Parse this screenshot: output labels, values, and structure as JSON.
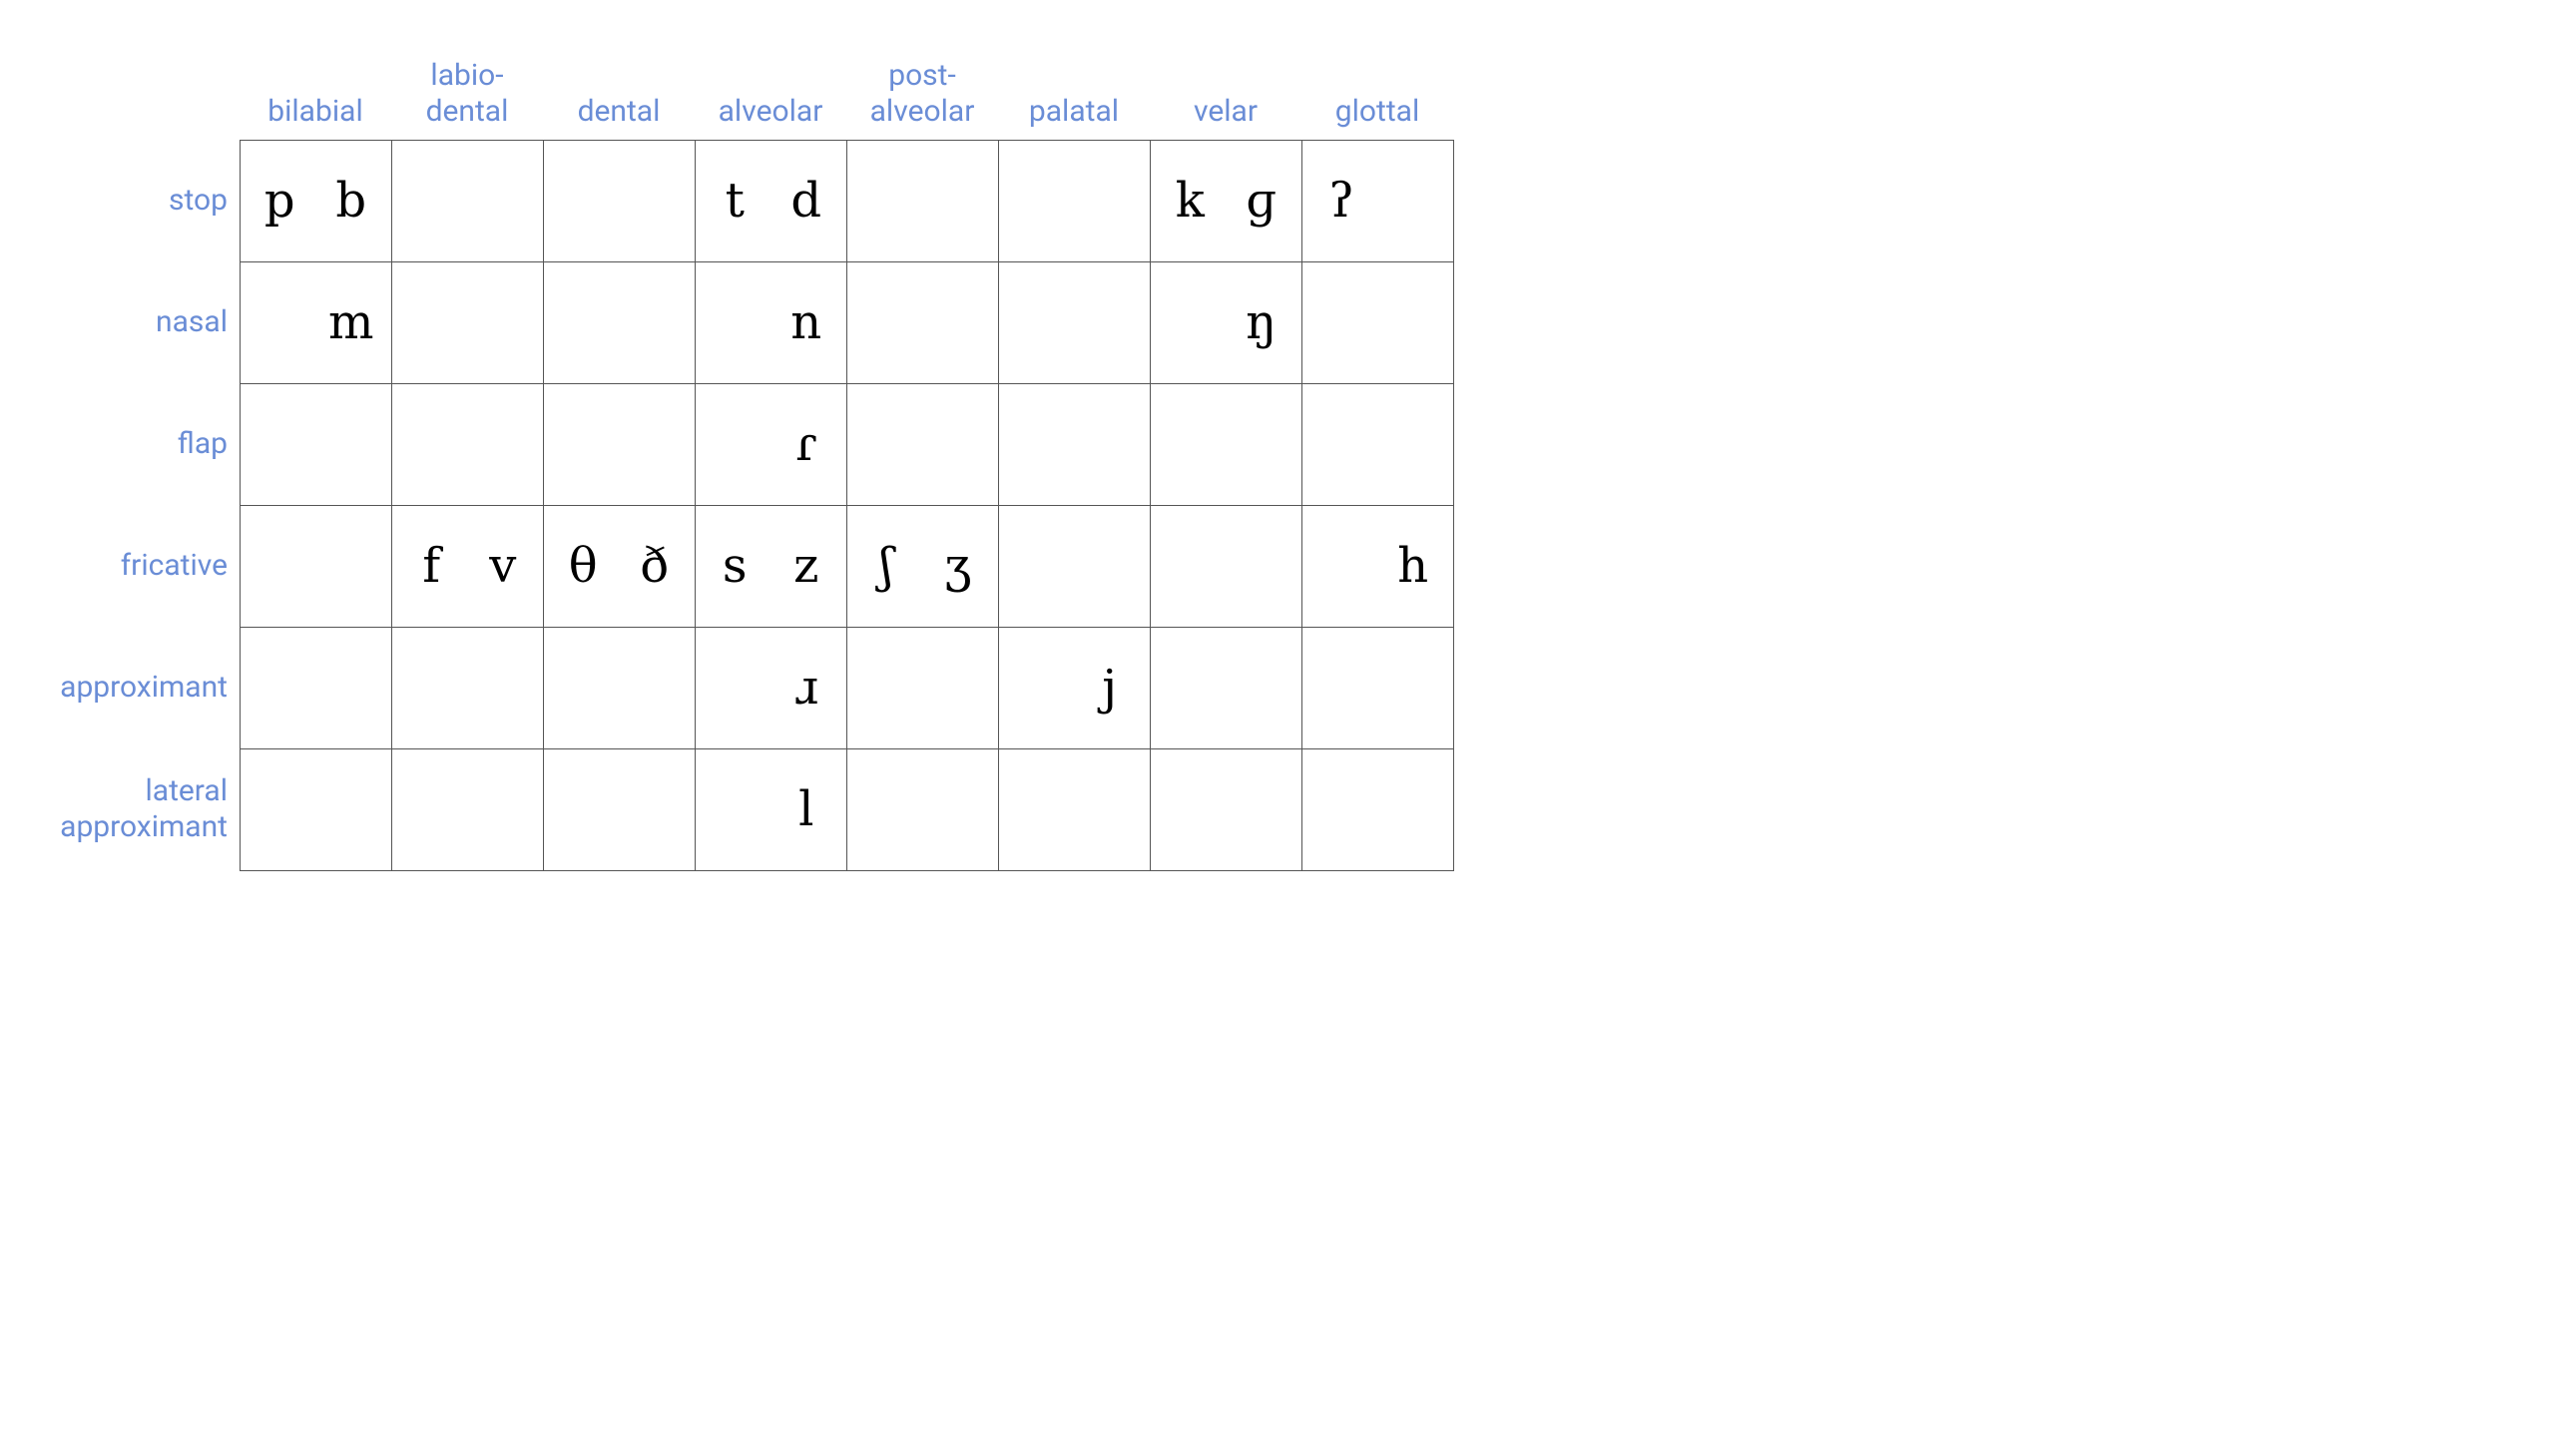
{
  "columns": [
    "bilabial",
    "labio-\ndental",
    "dental",
    "alveolar",
    "post-\nalveolar",
    "palatal",
    "velar",
    "glottal"
  ],
  "rows": [
    "stop",
    "nasal",
    "flap",
    "fricative",
    "approximant",
    "lateral\napproximant"
  ],
  "cells": [
    [
      [
        "p",
        "b"
      ],
      [
        "",
        ""
      ],
      [
        "",
        ""
      ],
      [
        "t",
        "d"
      ],
      [
        "",
        ""
      ],
      [
        "",
        ""
      ],
      [
        "k",
        "ɡ"
      ],
      [
        "ʔ",
        ""
      ]
    ],
    [
      [
        "",
        "m"
      ],
      [
        "",
        ""
      ],
      [
        "",
        ""
      ],
      [
        "",
        "n"
      ],
      [
        "",
        ""
      ],
      [
        "",
        ""
      ],
      [
        "",
        "ŋ"
      ],
      [
        "",
        ""
      ]
    ],
    [
      [
        "",
        ""
      ],
      [
        "",
        ""
      ],
      [
        "",
        ""
      ],
      [
        "",
        "ɾ"
      ],
      [
        "",
        ""
      ],
      [
        "",
        ""
      ],
      [
        "",
        ""
      ],
      [
        "",
        ""
      ]
    ],
    [
      [
        "",
        ""
      ],
      [
        "f",
        "v"
      ],
      [
        "θ",
        "ð"
      ],
      [
        "s",
        "z"
      ],
      [
        "ʃ",
        "ʒ"
      ],
      [
        "",
        ""
      ],
      [
        "",
        ""
      ],
      [
        "",
        "h"
      ]
    ],
    [
      [
        "",
        ""
      ],
      [
        "",
        ""
      ],
      [
        "",
        ""
      ],
      [
        "",
        "ɹ"
      ],
      [
        "",
        ""
      ],
      [
        "",
        "j"
      ],
      [
        "",
        ""
      ],
      [
        "",
        ""
      ]
    ],
    [
      [
        "",
        ""
      ],
      [
        "",
        ""
      ],
      [
        "",
        ""
      ],
      [
        "",
        "l"
      ],
      [
        "",
        ""
      ],
      [
        "",
        ""
      ],
      [
        "",
        ""
      ],
      [
        "",
        ""
      ]
    ]
  ]
}
